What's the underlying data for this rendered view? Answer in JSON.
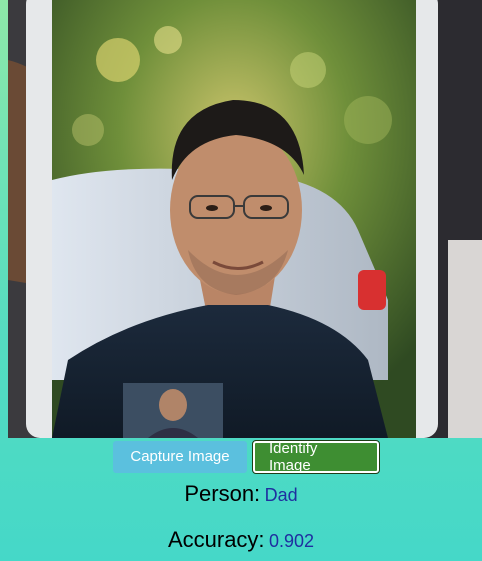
{
  "camera": {
    "icon": "camera-feed-photo"
  },
  "controls": {
    "capture_label": "Capture Image",
    "identify_label": "Identify Image"
  },
  "result": {
    "person_label": "Person:",
    "person_value": "Dad",
    "accuracy_label": "Accuracy:",
    "accuracy_value": "0.902"
  },
  "colors": {
    "capture_button": "#5bc0de",
    "identify_button": "#3e8e32",
    "result_value": "#1f2fa0"
  }
}
